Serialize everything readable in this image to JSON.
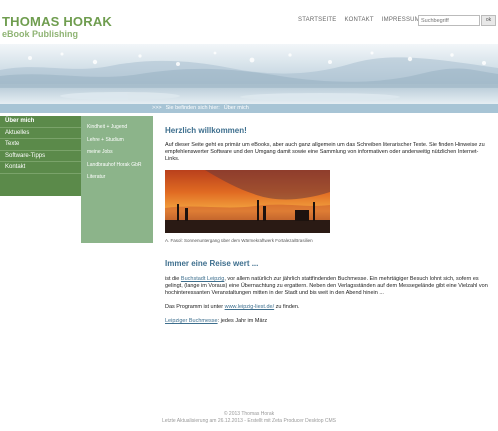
{
  "brand": {
    "title": "THOMAS HORAK",
    "subtitle": "eBook Publishing"
  },
  "topnav": {
    "items": [
      "STARTSEITE",
      "KONTAKT",
      "IMPRESSUM"
    ]
  },
  "search": {
    "placeholder": "Suchbegriff",
    "button_label": "ok"
  },
  "breadcrumb": {
    "arrows": ">>>",
    "prefix": "Sie befinden sich hier:",
    "current": "Über mich"
  },
  "sidebar": {
    "items": [
      {
        "label": "Über mich"
      },
      {
        "label": "Aktuelles"
      },
      {
        "label": "Texte"
      },
      {
        "label": "Software-Tipps"
      },
      {
        "label": "Kontakt"
      }
    ]
  },
  "subnav": {
    "items": [
      {
        "label": "Kindheit + Jugend"
      },
      {
        "label": "Lehre + Studium"
      },
      {
        "label": "meine Jobs"
      },
      {
        "label": "Landbrauhof Horak GbR"
      },
      {
        "label": "Literatur"
      }
    ]
  },
  "content": {
    "welcome_heading": "Herzlich willkommen!",
    "welcome_text": "Auf dieser Seite geht es primär um eBooks, aber auch ganz allgemein um das Schreiben literarischer Texte. Sie finden Hinweise zu empfehlenswerter Software und den Umgang damit sowie eine Sammlung von informativen oder anderweitig nützlichen Internet-Links.",
    "photo_caption": "A. Fasol: Sonnenuntergang über dem Wärmekraftwerk Fortaleza/Brasilien",
    "trip_heading": "Immer eine Reise wert ...",
    "trip_text_1": "ist die ",
    "trip_link_1": "Buchstadt Leipzig",
    "trip_text_2": ", vor allem natürlich zur jährlich stattfindenden Buchmesse. Ein mehrtägiger Besuch lohnt sich, sofern es gelingt, (lange im Voraus) eine Übernachtung zu ergattern. Neben den Verlagsständen auf dem Messegelände gibt eine Vielzahl von hochinteressanten Veranstaltungen mitten in der Stadt und bis weit in den Abend hinein ...",
    "program_text_1": "Das Programm ist unter ",
    "program_link": "www.leipzig-liest.de/",
    "program_text_2": " zu finden.",
    "fair_link": "Leipziger Buchmesse",
    "fair_text": ": jedes Jahr im März"
  },
  "footer": {
    "line1": "© 2013 Thomas Horak",
    "line2": "Letzte Aktualisierung am 26.12.2013 - Erstellt mit Zeta Producer Desktop CMS"
  }
}
